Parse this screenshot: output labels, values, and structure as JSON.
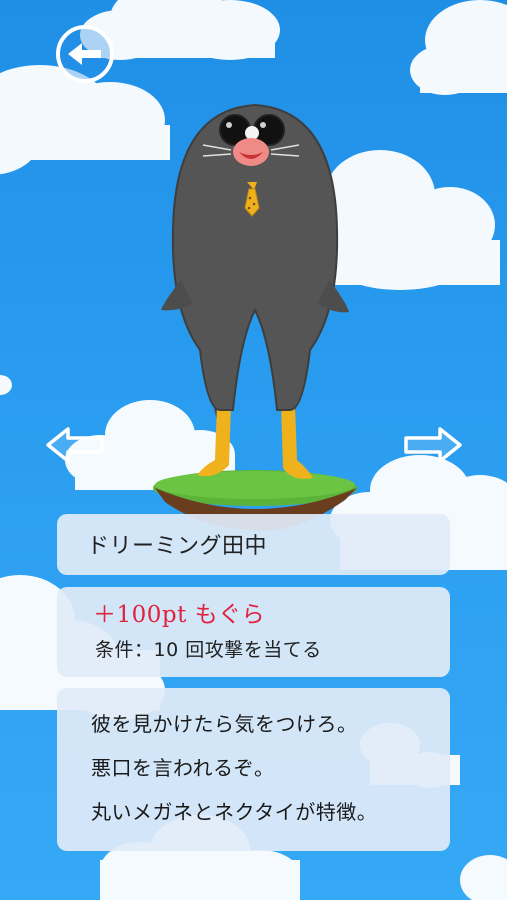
{
  "character": {
    "name": "ドリーミング田中",
    "reward": "＋100pt もぐら",
    "condition": "条件：10 回攻撃を当てる",
    "description": [
      "彼を見かけたら気をつけろ。",
      "悪口を言われるぞ。",
      "丸いメガネとネクタイが特徴。"
    ]
  },
  "icons": {
    "back": "back-arrow-icon",
    "prev": "left-arrow-icon",
    "next": "right-arrow-icon"
  },
  "colors": {
    "sky": "#2a9df0",
    "reward": "#e0223f",
    "mole_body": "#555555",
    "tie": "#f0b21c",
    "grass": "#5bb33a"
  }
}
